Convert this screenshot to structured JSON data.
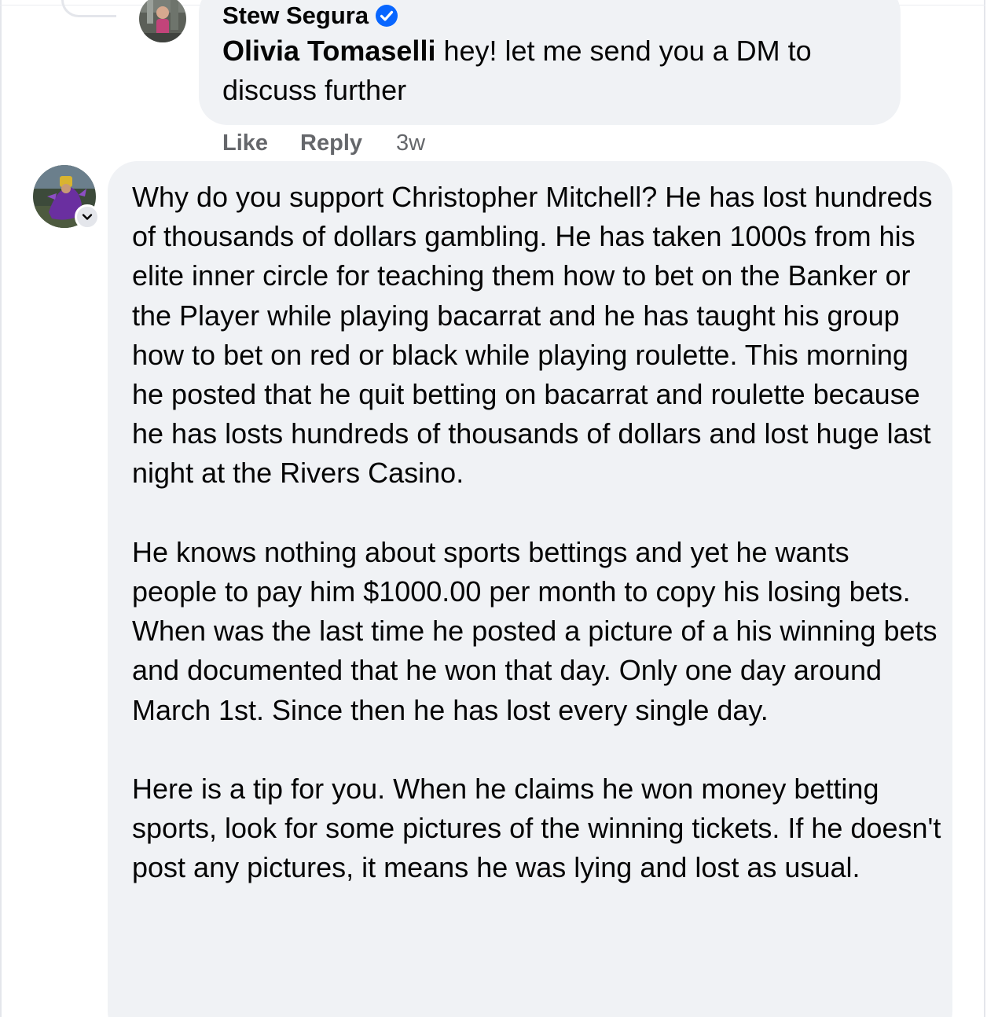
{
  "reply": {
    "author": "Stew Segura",
    "mention": "Olivia Tomaselli",
    "text": " hey! let me send you a DM to discuss further",
    "actions": {
      "like_label": "Like",
      "reply_label": "Reply",
      "time": "3w"
    }
  },
  "comment": {
    "paragraphs": [
      "Why do you support Christopher Mitchell? He has lost hundreds of thousands of dollars gambling. He has taken 1000s from his elite inner circle for teaching them how to bet on the Banker or the Player while playing bacarrat and he has taught his group how to bet on red or black while playing roulette. This morning he posted that he quit betting on bacarrat and roulette because he has losts hundreds of thousands of dollars and lost huge last night at the Rivers Casino.",
      "He knows nothing about sports bettings and yet he wants people to pay him $1000.00 per month to copy his losing bets. When was the last time he posted a picture of a his winning bets and documented that he won that day. Only one day around March 1st. Since then he has lost every single day.",
      "Here is a tip for you. When he claims he won money betting sports, look for some pictures of the winning tickets. If he doesn't post any pictures, it means he was lying and lost as usual."
    ]
  },
  "icons": {
    "verified": "verified-badge-icon",
    "avatar_menu": "chevron-down-icon"
  },
  "colors": {
    "bubble": "#f0f2f5",
    "verified": "#0866ff",
    "secondary_text": "#65676b"
  }
}
